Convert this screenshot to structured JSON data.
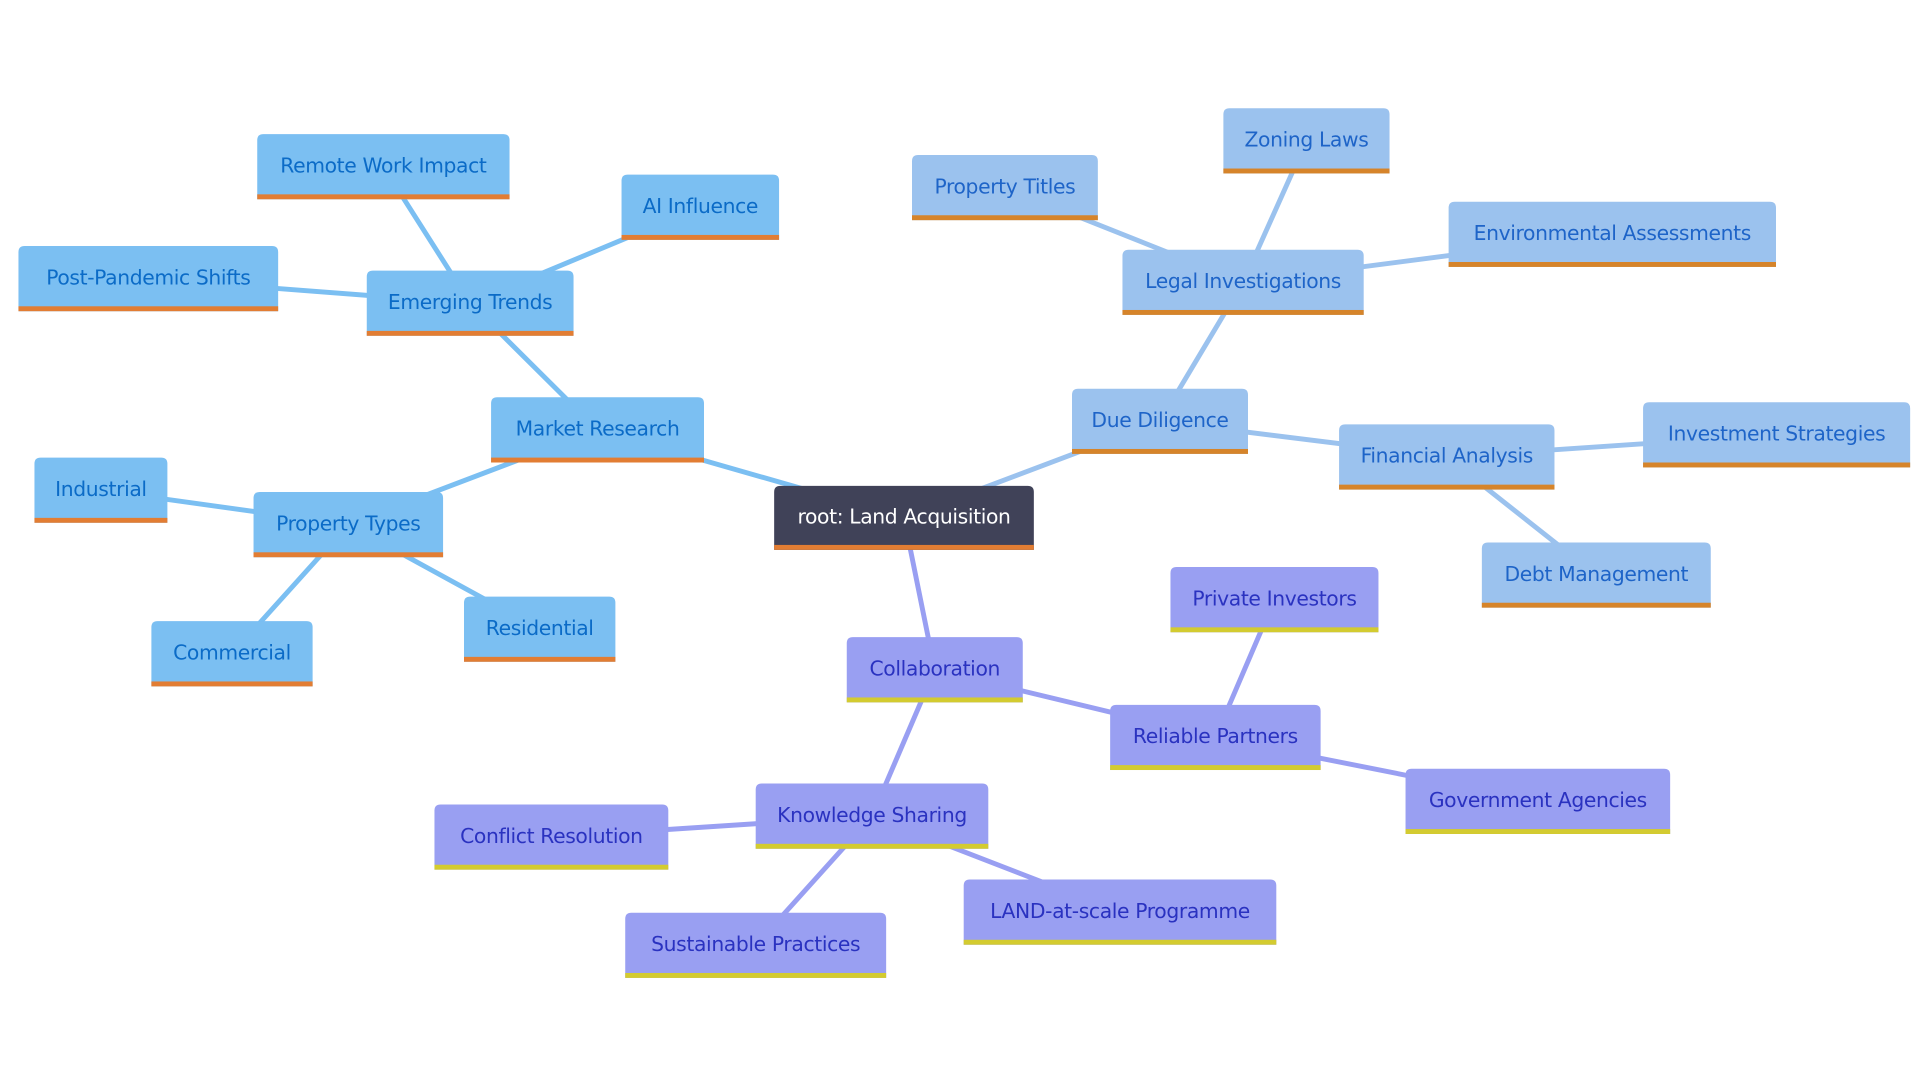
{
  "diagram": {
    "type": "mindmap",
    "root": {
      "id": "root",
      "label": "root: Land Acquisition"
    },
    "branches": [
      {
        "id": "market",
        "label": "Market Research",
        "style": "blue",
        "children": [
          {
            "id": "trends",
            "label": "Emerging Trends",
            "children": [
              {
                "id": "remote",
                "label": "Remote Work Impact"
              },
              {
                "id": "ai",
                "label": "AI Influence"
              },
              {
                "id": "postpandemic",
                "label": "Post-Pandemic Shifts"
              }
            ]
          },
          {
            "id": "ptypes",
            "label": "Property Types",
            "children": [
              {
                "id": "industrial",
                "label": "Industrial"
              },
              {
                "id": "commercial",
                "label": "Commercial"
              },
              {
                "id": "residential",
                "label": "Residential"
              }
            ]
          }
        ]
      },
      {
        "id": "due",
        "label": "Due Diligence",
        "style": "lightblue",
        "children": [
          {
            "id": "legal",
            "label": "Legal Investigations",
            "children": [
              {
                "id": "titles",
                "label": "Property Titles"
              },
              {
                "id": "zoning",
                "label": "Zoning Laws"
              },
              {
                "id": "env",
                "label": "Environmental Assessments"
              }
            ]
          },
          {
            "id": "financial",
            "label": "Financial Analysis",
            "children": [
              {
                "id": "invest",
                "label": "Investment Strategies"
              },
              {
                "id": "debt",
                "label": "Debt Management"
              }
            ]
          }
        ]
      },
      {
        "id": "collab",
        "label": "Collaboration",
        "style": "purple",
        "children": [
          {
            "id": "partners",
            "label": "Reliable Partners",
            "children": [
              {
                "id": "private",
                "label": "Private Investors"
              },
              {
                "id": "gov",
                "label": "Government Agencies"
              }
            ]
          },
          {
            "id": "knowledge",
            "label": "Knowledge Sharing",
            "children": [
              {
                "id": "conflict",
                "label": "Conflict Resolution"
              },
              {
                "id": "sustain",
                "label": "Sustainable Practices"
              },
              {
                "id": "landscale",
                "label": "LAND-at-scale Programme"
              }
            ]
          }
        ]
      }
    ]
  },
  "styles": {
    "root": {
      "fill": "#404258",
      "text": "#ffffff",
      "border": "#E27D33",
      "edge": "#7BBFF2"
    },
    "blue": {
      "fill": "#7BBFF2",
      "text": "#0B6BC7",
      "border": "#E27D33",
      "edge": "#7BBFF2"
    },
    "lightblue": {
      "fill": "#9BC2EE",
      "text": "#1E64C8",
      "border": "#D6842A",
      "edge": "#9BC2EE"
    },
    "purple": {
      "fill": "#999FF2",
      "text": "#2A32C0",
      "border": "#D3CB30",
      "edge": "#999FF2"
    }
  }
}
